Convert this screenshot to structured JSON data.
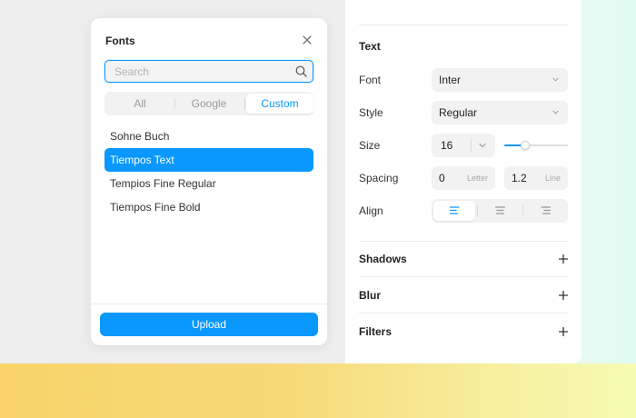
{
  "fonts_popup": {
    "title": "Fonts",
    "close_icon": "close-icon",
    "search": {
      "placeholder": "Search",
      "value": "",
      "icon": "search-icon"
    },
    "tabs": [
      {
        "label": "All",
        "active": false
      },
      {
        "label": "Google",
        "active": false
      },
      {
        "label": "Custom",
        "active": true
      }
    ],
    "fonts": [
      {
        "name": "Sohne Buch",
        "selected": false
      },
      {
        "name": "Tiempos Text",
        "selected": true
      },
      {
        "name": "Tempios Fine Regular",
        "selected": false
      },
      {
        "name": "Tiempos Fine Bold",
        "selected": false
      }
    ],
    "upload_label": "Upload"
  },
  "text_panel": {
    "title": "Text",
    "font": {
      "label": "Font",
      "value": "Inter"
    },
    "style": {
      "label": "Style",
      "value": "Regular"
    },
    "size": {
      "label": "Size",
      "value": "16",
      "slider_fraction": 0.33
    },
    "spacing": {
      "label": "Spacing",
      "letter": {
        "value": "0",
        "unit": "Letter"
      },
      "line": {
        "value": "1.2",
        "unit": "Line"
      }
    },
    "align": {
      "label": "Align",
      "options": [
        "left",
        "center",
        "right"
      ],
      "selected": "left"
    }
  },
  "sections": [
    {
      "title": "Shadows",
      "icon": "plus-icon"
    },
    {
      "title": "Blur",
      "icon": "plus-icon"
    },
    {
      "title": "Filters",
      "icon": "plus-icon"
    }
  ],
  "colors": {
    "accent": "#0a98ff",
    "panel_bg": "#ffffff",
    "canvas_bg": "#eeeeee"
  }
}
